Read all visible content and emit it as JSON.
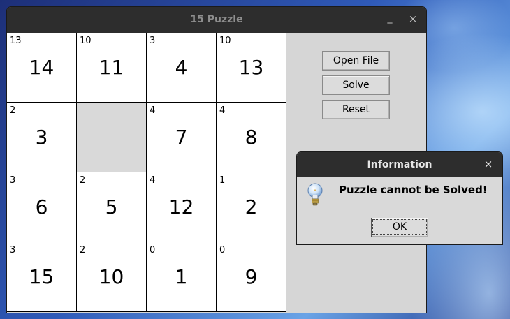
{
  "window": {
    "title": "15 Puzzle",
    "minimize_glyph": "_",
    "close_glyph": "×"
  },
  "board": {
    "tiles": [
      {
        "hint": "13",
        "number": "14"
      },
      {
        "hint": "10",
        "number": "11"
      },
      {
        "hint": "3",
        "number": "4"
      },
      {
        "hint": "10",
        "number": "13"
      },
      {
        "hint": "2",
        "number": "3"
      },
      {
        "hint": "",
        "number": ""
      },
      {
        "hint": "4",
        "number": "7"
      },
      {
        "hint": "4",
        "number": "8"
      },
      {
        "hint": "3",
        "number": "6"
      },
      {
        "hint": "2",
        "number": "5"
      },
      {
        "hint": "4",
        "number": "12"
      },
      {
        "hint": "1",
        "number": "2"
      },
      {
        "hint": "3",
        "number": "15"
      },
      {
        "hint": "2",
        "number": "10"
      },
      {
        "hint": "0",
        "number": "1"
      },
      {
        "hint": "0",
        "number": "9"
      }
    ]
  },
  "controls": {
    "open_file": "Open File",
    "solve": "Solve",
    "reset": "Reset"
  },
  "dialog": {
    "title": "Information",
    "close_glyph": "×",
    "icon": "lightbulb-icon",
    "message": "Puzzle cannot be Solved!",
    "ok": "OK"
  }
}
